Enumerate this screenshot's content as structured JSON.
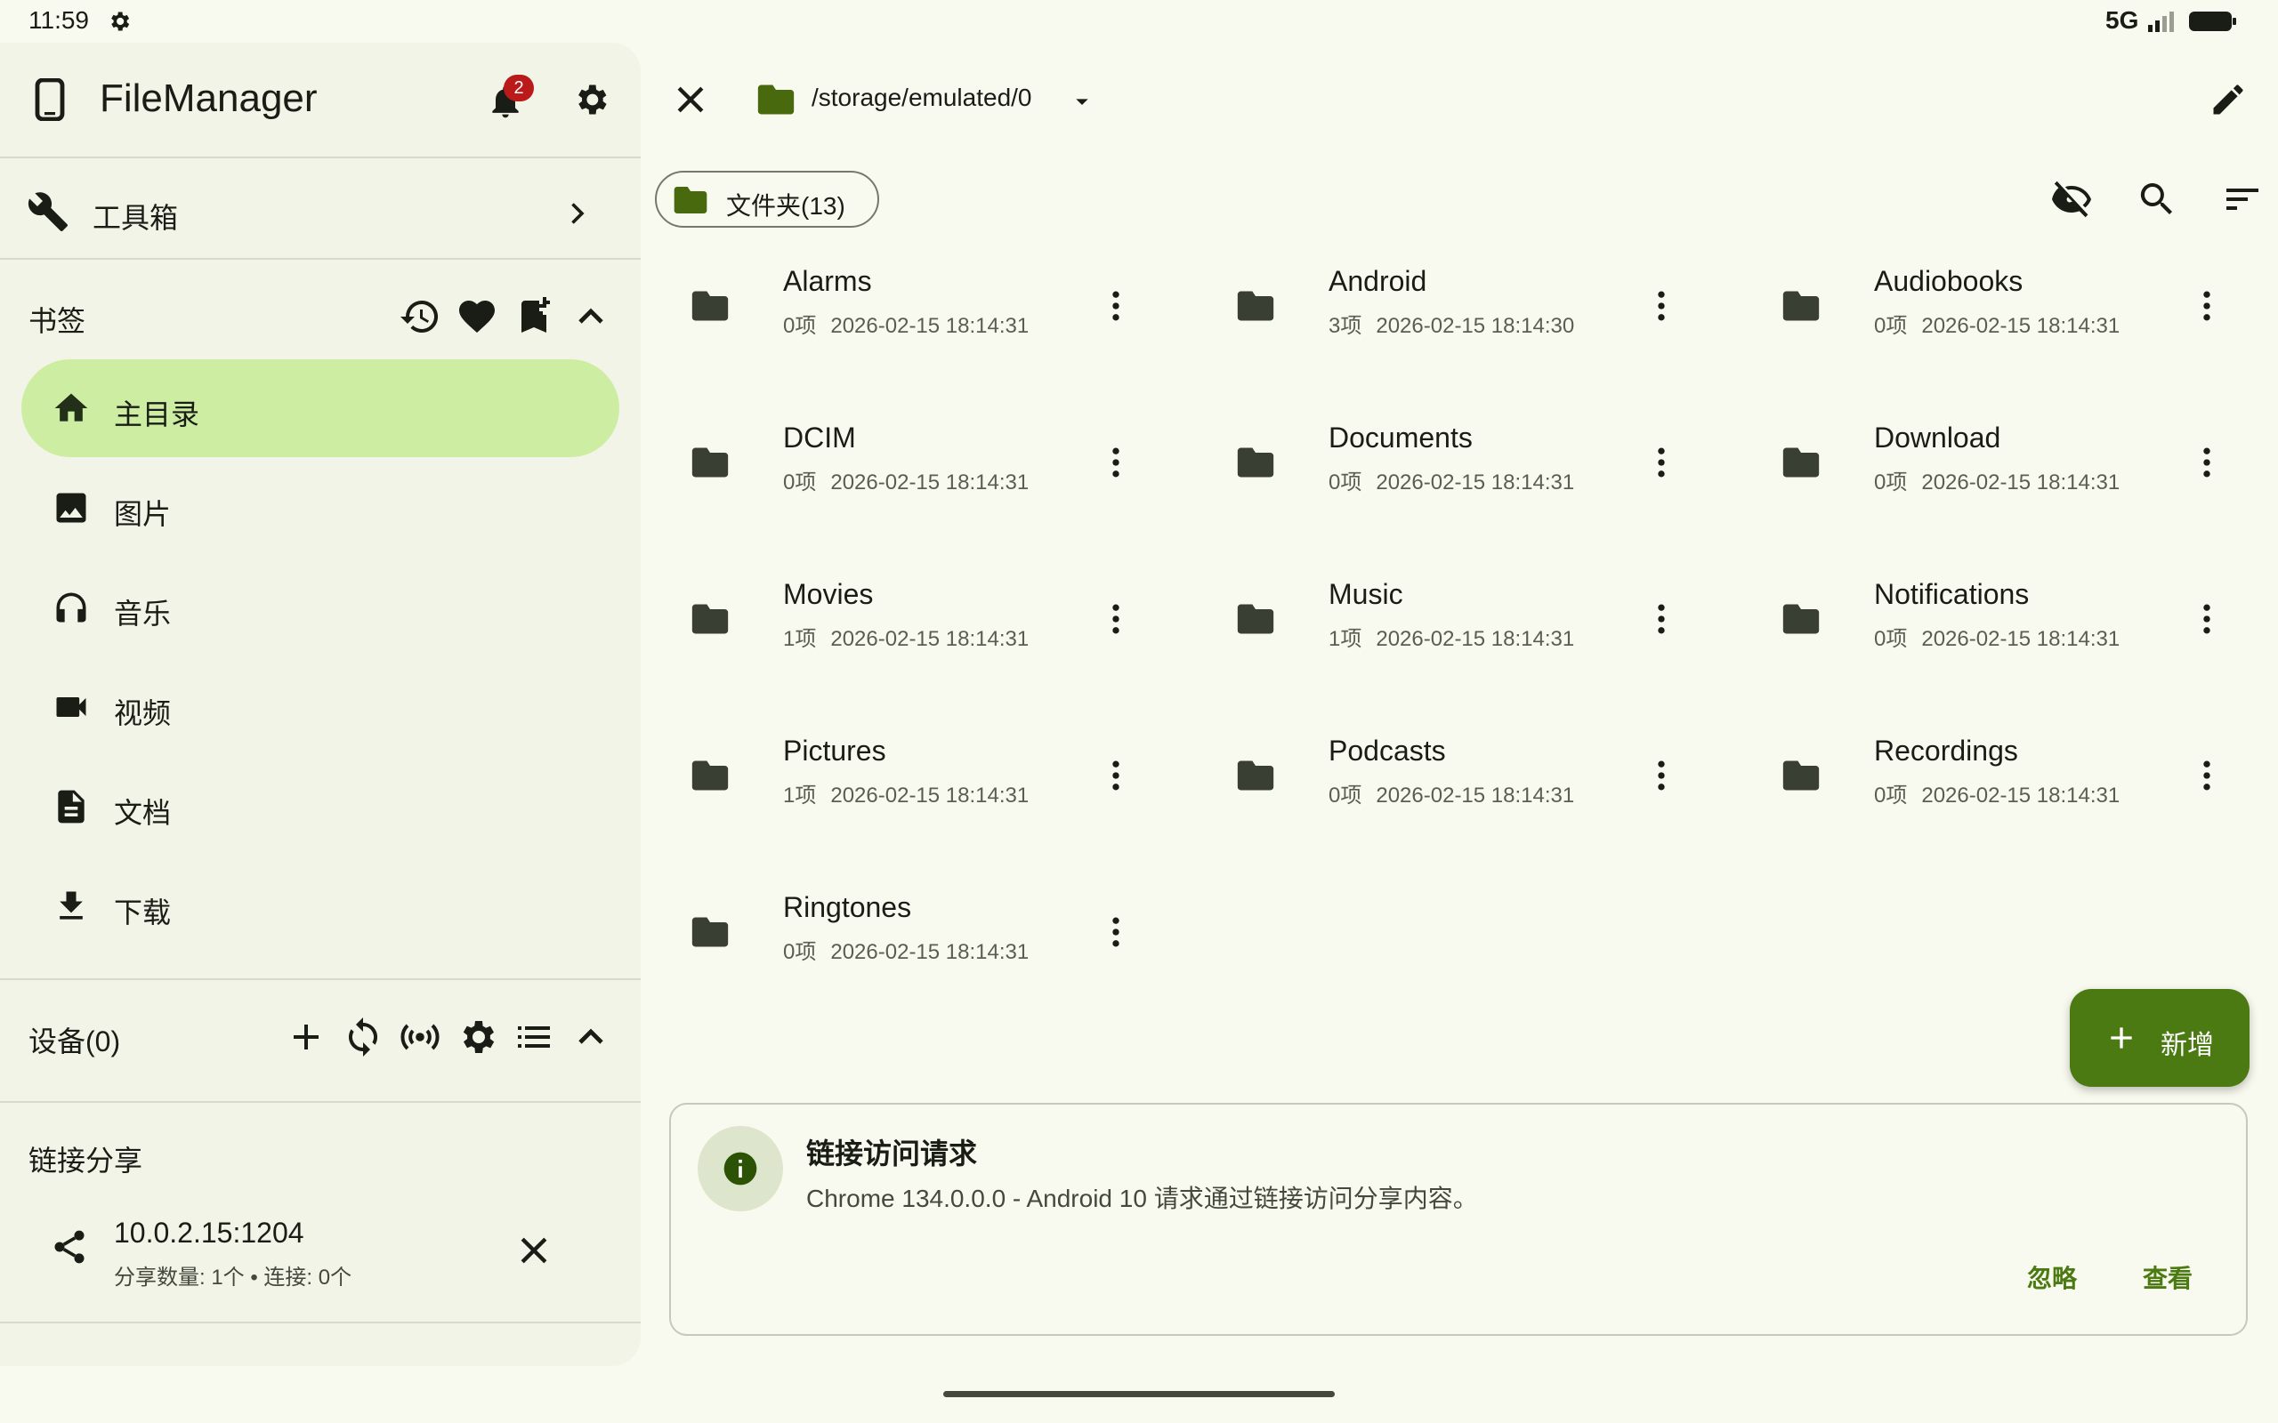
{
  "status_bar": {
    "time": "11:59",
    "network": "5G",
    "icons": [
      "settings-icon",
      "signal-icon",
      "battery-icon"
    ]
  },
  "sidebar": {
    "app_title": "FileManager",
    "notification_count": "2",
    "toolbox_label": "工具箱",
    "bookmarks": {
      "title": "书签",
      "items": [
        {
          "label": "主目录",
          "icon": "home-icon",
          "active": true
        },
        {
          "label": "图片",
          "icon": "image-icon",
          "active": false
        },
        {
          "label": "音乐",
          "icon": "headphones-icon",
          "active": false
        },
        {
          "label": "视频",
          "icon": "video-icon",
          "active": false
        },
        {
          "label": "文档",
          "icon": "document-icon",
          "active": false
        },
        {
          "label": "下载",
          "icon": "download-icon",
          "active": false
        }
      ]
    },
    "devices": {
      "title": "设备(0)"
    },
    "link_share": {
      "title": "链接分享",
      "address": "10.0.2.15:1204",
      "stats": "分享数量: 1个 • 连接: 0个"
    }
  },
  "main": {
    "path": "/storage/emulated/0",
    "filter_chip": "文件夹(13)",
    "files": [
      {
        "name": "Alarms",
        "count": "0项",
        "date": "2026-02-15 18:14:31"
      },
      {
        "name": "Android",
        "count": "3项",
        "date": "2026-02-15 18:14:30"
      },
      {
        "name": "Audiobooks",
        "count": "0项",
        "date": "2026-02-15 18:14:31"
      },
      {
        "name": "DCIM",
        "count": "0项",
        "date": "2026-02-15 18:14:31"
      },
      {
        "name": "Documents",
        "count": "0项",
        "date": "2026-02-15 18:14:31"
      },
      {
        "name": "Download",
        "count": "0项",
        "date": "2026-02-15 18:14:31"
      },
      {
        "name": "Movies",
        "count": "1项",
        "date": "2026-02-15 18:14:31"
      },
      {
        "name": "Music",
        "count": "1项",
        "date": "2026-02-15 18:14:31"
      },
      {
        "name": "Notifications",
        "count": "0项",
        "date": "2026-02-15 18:14:31"
      },
      {
        "name": "Pictures",
        "count": "1项",
        "date": "2026-02-15 18:14:31"
      },
      {
        "name": "Podcasts",
        "count": "0项",
        "date": "2026-02-15 18:14:31"
      },
      {
        "name": "Recordings",
        "count": "0项",
        "date": "2026-02-15 18:14:31"
      },
      {
        "name": "Ringtones",
        "count": "0项",
        "date": "2026-02-15 18:14:31"
      }
    ],
    "fab_label": "新增"
  },
  "dialog": {
    "title": "链接访问请求",
    "message": "Chrome 134.0.0.0 - Android 10 请求通过链接访问分享内容。",
    "ignore_label": "忽略",
    "view_label": "查看"
  },
  "colors": {
    "accent": "#4c7a12",
    "active_bg": "#cdeda3",
    "folder": "#49690f",
    "badge": "#ba1a1a"
  }
}
